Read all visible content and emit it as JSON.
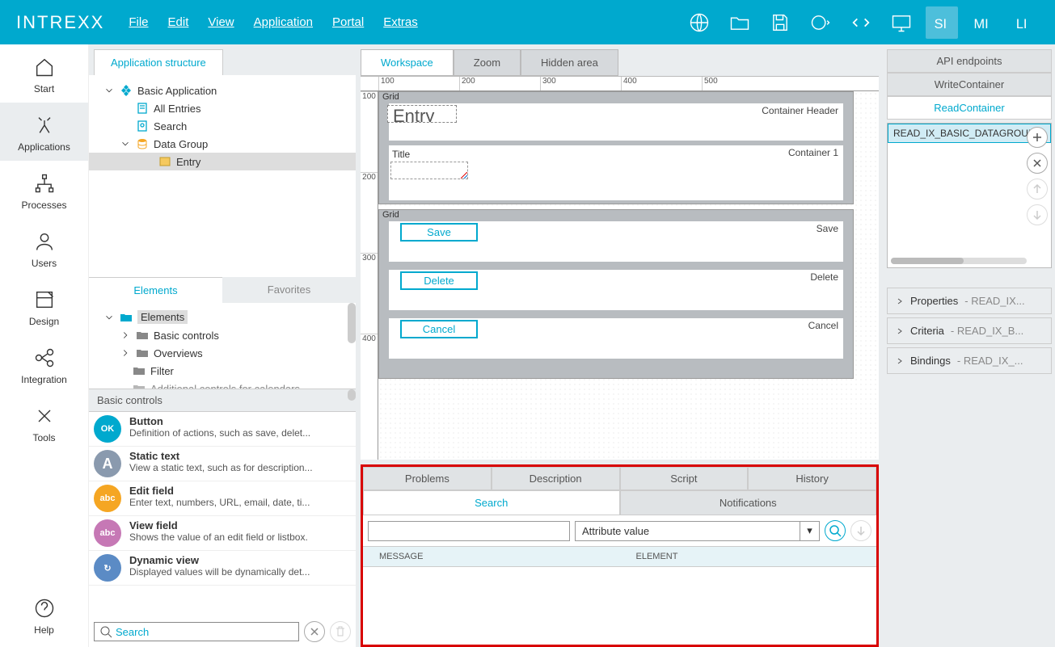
{
  "app": {
    "logo": "INTREXX"
  },
  "menu": {
    "file": "File",
    "edit": "Edit",
    "view": "View",
    "application": "Application",
    "portal": "Portal",
    "extras": "Extras"
  },
  "leftnav": {
    "start": "Start",
    "applications": "Applications",
    "processes": "Processes",
    "users": "Users",
    "design": "Design",
    "integration": "Integration",
    "tools": "Tools",
    "help": "Help"
  },
  "structure": {
    "tab": "Application structure",
    "tree": {
      "root": "Basic Application",
      "allentries": "All Entries",
      "search": "Search",
      "datagroup": "Data Group",
      "entry": "Entry"
    }
  },
  "elements": {
    "tabs": {
      "elements": "Elements",
      "favorites": "Favorites"
    },
    "root": "Elements",
    "cats": {
      "basic": "Basic controls",
      "overviews": "Overviews",
      "filter": "Filter",
      "addcal": "Additional controls for calendars"
    },
    "catHead": "Basic controls",
    "items": [
      {
        "badge": "OK",
        "color": "#00A9CE",
        "title": "Button",
        "desc": "Definition of actions, such as save, delet..."
      },
      {
        "badge": "A",
        "color": "#8A9AAE",
        "title": "Static text",
        "desc": "View a static text, such as for description..."
      },
      {
        "badge": "abc",
        "color": "#F5A623",
        "title": "Edit field",
        "desc": "Enter text, numbers, URL, email, date, ti..."
      },
      {
        "badge": "abc",
        "color": "#C678B5",
        "title": "View field",
        "desc": "Shows the value of an edit field or listbox."
      },
      {
        "badge": "↻",
        "color": "#5B8BC5",
        "title": "Dynamic view",
        "desc": "Displayed values will be dynamically det..."
      }
    ],
    "searchPlaceholder": "Search"
  },
  "canvas": {
    "tabs": {
      "workspace": "Workspace",
      "zoom": "Zoom",
      "hidden": "Hidden area"
    },
    "rulerH": [
      "100",
      "200",
      "300",
      "400",
      "500"
    ],
    "rulerV": [
      "100",
      "200",
      "300",
      "400"
    ],
    "grid1Label": "Grid",
    "containerHeader": "Container Header",
    "entryTitle": "Entry",
    "titleLabel": "Title",
    "container1": "Container 1",
    "grid2Label": "Grid",
    "save": "Save",
    "saveLabel": "Save",
    "delete": "Delete",
    "deleteLabel": "Delete",
    "cancel": "Cancel",
    "cancelLabel": "Cancel"
  },
  "bottom": {
    "tabs1": {
      "problems": "Problems",
      "description": "Description",
      "script": "Script",
      "history": "History"
    },
    "tabs2": {
      "search": "Search",
      "notifications": "Notifications"
    },
    "selectValue": "Attribute value",
    "col1": "MESSAGE",
    "col2": "ELEMENT"
  },
  "right": {
    "tabs": {
      "api": "API endpoints",
      "write": "WriteContainer",
      "read": "ReadContainer"
    },
    "boxItem": "READ_IX_BASIC_DATAGROUP",
    "acc": {
      "properties": "Properties",
      "propertiesSec": "- READ_IX...",
      "criteria": "Criteria",
      "criteriaSec": "- READ_IX_B...",
      "bindings": "Bindings",
      "bindingsSec": "- READ_IX_..."
    }
  }
}
